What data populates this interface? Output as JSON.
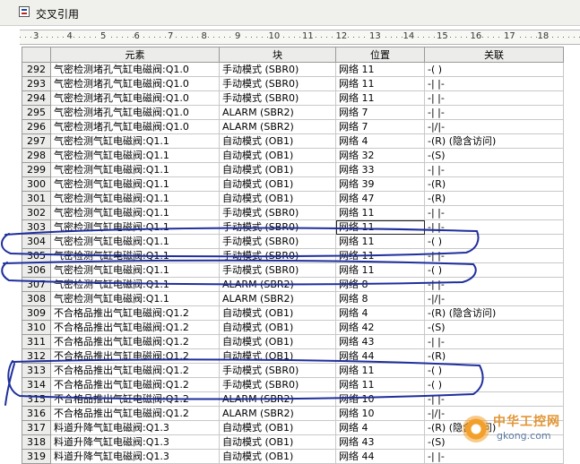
{
  "window": {
    "title": "交叉引用"
  },
  "ruler": {
    "ticks": [
      "3",
      "4",
      "5",
      "6",
      "7",
      "8",
      "9",
      "10",
      "11",
      "12",
      "13",
      "14",
      "15",
      "16",
      "17",
      "18"
    ]
  },
  "table": {
    "columns": [
      "",
      "元素",
      "块",
      "位置",
      "关联"
    ],
    "rows": [
      {
        "n": "292",
        "element": "气密检测堵孔气缸电磁阀:Q1.0",
        "block": "手动模式 (SBR0)",
        "location": "网络 11",
        "relation": "-( )"
      },
      {
        "n": "293",
        "element": "气密检测堵孔气缸电磁阀:Q1.0",
        "block": "手动模式 (SBR0)",
        "location": "网络 11",
        "relation": "-| |-"
      },
      {
        "n": "294",
        "element": "气密检测堵孔气缸电磁阀:Q1.0",
        "block": "手动模式 (SBR0)",
        "location": "网络 11",
        "relation": "-| |-"
      },
      {
        "n": "295",
        "element": "气密检测堵孔气缸电磁阀:Q1.0",
        "block": "ALARM (SBR2)",
        "location": "网络 7",
        "relation": "-| |-"
      },
      {
        "n": "296",
        "element": "气密检测堵孔气缸电磁阀:Q1.0",
        "block": "ALARM (SBR2)",
        "location": "网络 7",
        "relation": "-|/|-"
      },
      {
        "n": "297",
        "element": "气密检测气缸电磁阀:Q1.1",
        "block": "自动模式 (OB1)",
        "location": "网络 4",
        "relation": "-(R) (隐含访问)"
      },
      {
        "n": "298",
        "element": "气密检测气缸电磁阀:Q1.1",
        "block": "自动模式 (OB1)",
        "location": "网络 32",
        "relation": "-(S)"
      },
      {
        "n": "299",
        "element": "气密检测气缸电磁阀:Q1.1",
        "block": "自动模式 (OB1)",
        "location": "网络 33",
        "relation": "-| |-"
      },
      {
        "n": "300",
        "element": "气密检测气缸电磁阀:Q1.1",
        "block": "自动模式 (OB1)",
        "location": "网络 39",
        "relation": "-(R)"
      },
      {
        "n": "301",
        "element": "气密检测气缸电磁阀:Q1.1",
        "block": "自动模式 (OB1)",
        "location": "网络 47",
        "relation": "-(R)"
      },
      {
        "n": "302",
        "element": "气密检测气缸电磁阀:Q1.1",
        "block": "手动模式 (SBR0)",
        "location": "网络 11",
        "relation": "-| |-"
      },
      {
        "n": "303",
        "element": "气密检测气缸电磁阀:Q1.1",
        "block": "手动模式 (SBR0)",
        "location": "网络 11",
        "relation": "-| |-"
      },
      {
        "n": "304",
        "element": "气密检测气缸电磁阀:Q1.1",
        "block": "手动模式 (SBR0)",
        "location": "网络 11",
        "relation": "-( )"
      },
      {
        "n": "305",
        "element": "气密检测气缸电磁阀:Q1.1",
        "block": "手动模式 (SBR0)",
        "location": "网络 11",
        "relation": "-| |-"
      },
      {
        "n": "306",
        "element": "气密检测气缸电磁阀:Q1.1",
        "block": "手动模式 (SBR0)",
        "location": "网络 11",
        "relation": "-( )"
      },
      {
        "n": "307",
        "element": "气密检测气缸电磁阀:Q1.1",
        "block": "ALARM (SBR2)",
        "location": "网络 8",
        "relation": "-| |-"
      },
      {
        "n": "308",
        "element": "气密检测气缸电磁阀:Q1.1",
        "block": "ALARM (SBR2)",
        "location": "网络 8",
        "relation": "-|/|-"
      },
      {
        "n": "309",
        "element": "不合格品推出气缸电磁阀:Q1.2",
        "block": "自动模式 (OB1)",
        "location": "网络 4",
        "relation": "-(R) (隐含访问)"
      },
      {
        "n": "310",
        "element": "不合格品推出气缸电磁阀:Q1.2",
        "block": "自动模式 (OB1)",
        "location": "网络 42",
        "relation": "-(S)"
      },
      {
        "n": "311",
        "element": "不合格品推出气缸电磁阀:Q1.2",
        "block": "自动模式 (OB1)",
        "location": "网络 43",
        "relation": "-| |-"
      },
      {
        "n": "312",
        "element": "不合格品推出气缸电磁阀:Q1.2",
        "block": "自动模式 (OB1)",
        "location": "网络 44",
        "relation": "-(R)"
      },
      {
        "n": "313",
        "element": "不合格品推出气缸电磁阀:Q1.2",
        "block": "手动模式 (SBR0)",
        "location": "网络 11",
        "relation": "-( )"
      },
      {
        "n": "314",
        "element": "不合格品推出气缸电磁阀:Q1.2",
        "block": "手动模式 (SBR0)",
        "location": "网络 11",
        "relation": "-( )"
      },
      {
        "n": "315",
        "element": "不合格品推出气缸电磁阀:Q1.2",
        "block": "ALARM (SBR2)",
        "location": "网络 10",
        "relation": "-| |-"
      },
      {
        "n": "316",
        "element": "不合格品推出气缸电磁阀:Q1.2",
        "block": "ALARM (SBR2)",
        "location": "网络 10",
        "relation": "-|/|-"
      },
      {
        "n": "317",
        "element": "料道升降气缸电磁阀:Q1.3",
        "block": "自动模式 (OB1)",
        "location": "网络 4",
        "relation": "-(R) (隐含访问)"
      },
      {
        "n": "318",
        "element": "料道升降气缸电磁阀:Q1.3",
        "block": "自动模式 (OB1)",
        "location": "网络 43",
        "relation": "-(S)"
      },
      {
        "n": "319",
        "element": "料道升降气缸电磁阀:Q1.3",
        "block": "自动模式 (OB1)",
        "location": "网络 44",
        "relation": "-| |-"
      }
    ]
  },
  "watermark": {
    "name": "中华工控网",
    "url": "gkong.com"
  },
  "colors": {
    "ink": "#1f2f9c",
    "header_bg": "#ececea",
    "watermark": "#e08a1e"
  }
}
